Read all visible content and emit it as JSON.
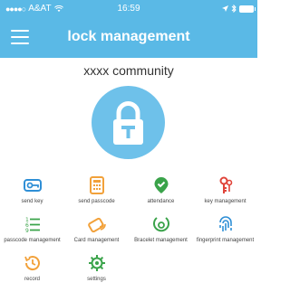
{
  "status_bar": {
    "carrier": "A&AT",
    "time": "16:59"
  },
  "header": {
    "title": "lock management"
  },
  "community_name": "xxxx community",
  "menu": [
    {
      "label": "send key",
      "icon": "send-key-icon",
      "color": "#2f8fd6"
    },
    {
      "label": "send passcode",
      "icon": "passcode-calculator-icon",
      "color": "#f2a13a"
    },
    {
      "label": "attendance",
      "icon": "attendance-check-icon",
      "color": "#3aa34a"
    },
    {
      "label": "key management",
      "icon": "key-management-icon",
      "color": "#e0443a"
    },
    {
      "label": "passcode management",
      "icon": "passcode-list-icon",
      "color": "#3aa34a"
    },
    {
      "label": "Card management",
      "icon": "card-icon",
      "color": "#f2a13a"
    },
    {
      "label": "Bracelet management",
      "icon": "bracelet-icon",
      "color": "#3aa34a"
    },
    {
      "label": "fingerprint management",
      "icon": "fingerprint-icon",
      "color": "#2f8fd6"
    },
    {
      "label": "record",
      "icon": "record-history-icon",
      "color": "#f2a13a"
    },
    {
      "label": "settings",
      "icon": "settings-gear-icon",
      "color": "#3aa34a"
    }
  ],
  "colors": {
    "header_bg": "#5ab9e6",
    "lock_circle": "#6ec1ea"
  }
}
